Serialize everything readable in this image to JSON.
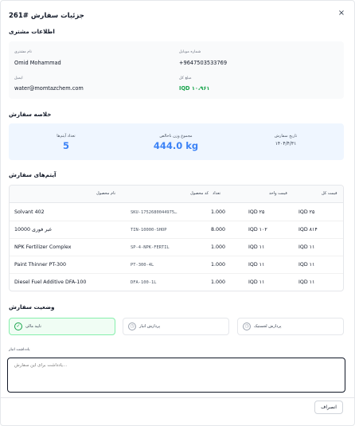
{
  "header": {
    "title": "جزئیات سفارش #261",
    "close_symbol": "×"
  },
  "customer": {
    "section_title": "اطلاعات مشتری",
    "name_label": "نام مشتری",
    "name_value": "Omid Mohammad",
    "phone_label": "شماره موبایل",
    "phone_value": "+9647503533769",
    "email_label": "ایمیل",
    "email_value": "water@momtazchem.com",
    "total_label": "مبلغ کل",
    "total_value": "IQD ۱۰،۹۶۱"
  },
  "summary": {
    "section_title": "خلاصه سفارش",
    "items_count_label": "تعداد آیتم‌ها",
    "items_count_value": "5",
    "weight_label": "مجموع وزن ناخالص",
    "weight_value": "444.0 kg",
    "date_label": "تاریخ سفارش",
    "date_value": "۱۴۰۴/۴/۳۱"
  },
  "items": {
    "section_title": "آیتم‌های سفارش",
    "columns": {
      "name": "نام محصول",
      "code": "کد محصول",
      "qty": "تعداد",
      "unit_price": "قیمت واحد",
      "total_price": "قیمت کل"
    },
    "rows": [
      {
        "name": "Solvant 402",
        "code": "SKU-1752680044975…",
        "qty": "1.000",
        "unit_price": "IQD ۲۵",
        "total_price": "IQD ۲۵"
      },
      {
        "name": "عبر فوری 10000",
        "code": "TIN-10000-SHOP",
        "qty": "8.000",
        "unit_price": "IQD ۱۰۲",
        "total_price": "IQD ۸۱۴"
      },
      {
        "name": "NPK Fertilizer Complex",
        "code": "SP-4-NPK-FERTIL",
        "qty": "1.000",
        "unit_price": "IQD ۱۱",
        "total_price": "IQD ۱۱"
      },
      {
        "name": "Paint Thinner PT-300",
        "code": "PT-300-4L",
        "qty": "1.000",
        "unit_price": "IQD ۱۱",
        "total_price": "IQD ۱۱"
      },
      {
        "name": "Diesel Fuel Additive DFA-100",
        "code": "DFA-100-1L",
        "qty": "1.000",
        "unit_price": "IQD ۱۱",
        "total_price": "IQD ۱۱"
      }
    ]
  },
  "status": {
    "section_title": "وضعیت سفارش",
    "steps": [
      {
        "label": "پردازش لجستیک",
        "icon": "clock-icon",
        "symbol": "◷"
      },
      {
        "label": "پردازش انبار",
        "icon": "clock-icon",
        "symbol": "◷"
      },
      {
        "label": "تایید مالی",
        "icon": "check-circle-icon",
        "symbol": "✓"
      }
    ]
  },
  "notes": {
    "label": "یادداشت انبار",
    "placeholder": "یادداشت برای این سفارش..."
  },
  "footer": {
    "cancel_label": "انصراف"
  },
  "colors": {
    "accent_blue": "#3b82f6",
    "success_green": "#16a34a",
    "summary_bg": "#eff6ff",
    "active_step_bg": "#f0fdf4"
  }
}
